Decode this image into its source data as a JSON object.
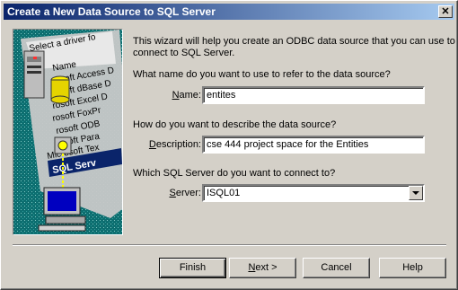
{
  "window": {
    "title": "Create a New Data Source to SQL Server",
    "close_glyph": "✕"
  },
  "art": {
    "list_header": "Select a driver fo",
    "list_items": [
      "Name",
      "rosoft Access D",
      "rosoft dBase D",
      "rosoft Excel D",
      "rosoft FoxPr",
      "rosoft ODB",
      "rosoft Para",
      "Microsoft Tex"
    ],
    "selected_item": "SQL Serv"
  },
  "intro": {
    "line1": "This wizard will help you create an ODBC data source that you can use to",
    "line2": "connect to SQL Server."
  },
  "name_section": {
    "question": "What name do you want to use to refer to the data source?",
    "label_u": "N",
    "label_rest": "ame:",
    "value": "entites"
  },
  "description_section": {
    "question": "How do you want to describe the data source?",
    "label_u": "D",
    "label_rest": "escription:",
    "value": "cse 444  project space for the Entities"
  },
  "server_section": {
    "question": "Which SQL Server do you want to connect to?",
    "label_u": "S",
    "label_rest": "erver:",
    "value": "ISQL01"
  },
  "buttons": {
    "finish": "Finish",
    "next_u": "N",
    "next_rest": "ext >",
    "cancel": "Cancel",
    "help": "Help"
  }
}
